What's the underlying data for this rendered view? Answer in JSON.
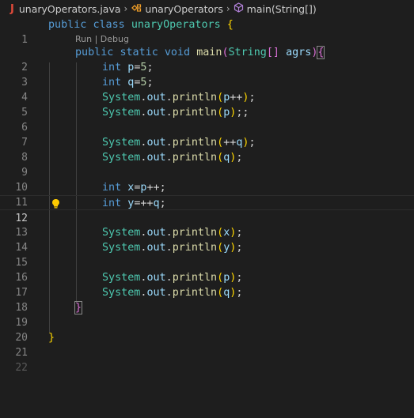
{
  "breadcrumb": {
    "file_icon": "J",
    "file": "unaryOperators.java",
    "class": "unaryOperators",
    "method": "main(String[])"
  },
  "codelens": {
    "run": "Run",
    "sep": " | ",
    "debug": "Debug"
  },
  "line_numbers": [
    "1",
    "2",
    "3",
    "4",
    "5",
    "6",
    "7",
    "8",
    "9",
    "10",
    "11",
    "12",
    "13",
    "14",
    "15",
    "16",
    "17",
    "18",
    "19",
    "20",
    "21",
    "22"
  ],
  "active_line": 12,
  "code": {
    "l1": [
      "public",
      "class",
      "unaryOperators",
      "{"
    ],
    "l2": [
      "public",
      "static",
      "void",
      "main",
      "(",
      "String",
      "[]",
      "agrs",
      ")",
      "{"
    ],
    "l3": [
      "int",
      "p",
      "=",
      "5",
      ";"
    ],
    "l4": [
      "int",
      "q",
      "=",
      "5",
      ";"
    ],
    "l5": [
      "System",
      ".",
      "out",
      ".",
      "println",
      "(",
      "p",
      "++",
      ")",
      ";"
    ],
    "l6": [
      "System",
      ".",
      "out",
      ".",
      "println",
      "(",
      "p",
      ")",
      ";;"
    ],
    "l8": [
      "System",
      ".",
      "out",
      ".",
      "println",
      "(",
      "++",
      "q",
      ")",
      ";"
    ],
    "l9": [
      "System",
      ".",
      "out",
      ".",
      "println",
      "(",
      "q",
      ")",
      ";"
    ],
    "l11": [
      "int",
      "x",
      "=",
      "p",
      "++",
      ";"
    ],
    "l12": [
      "int",
      "y",
      "=",
      "++",
      "q",
      ";"
    ],
    "l14": [
      "System",
      ".",
      "out",
      ".",
      "println",
      "(",
      "x",
      ")",
      ";"
    ],
    "l15": [
      "System",
      ".",
      "out",
      ".",
      "println",
      "(",
      "y",
      ")",
      ";"
    ],
    "l17": [
      "System",
      ".",
      "out",
      ".",
      "println",
      "(",
      "p",
      ")",
      ";"
    ],
    "l18": [
      "System",
      ".",
      "out",
      ".",
      "println",
      "(",
      "q",
      ")",
      ";"
    ],
    "l19": [
      "}"
    ],
    "l21": [
      "}"
    ]
  },
  "icons": {
    "file_icon": "java-file-icon",
    "class_icon": "class-symbol-icon",
    "method_icon": "method-symbol-icon",
    "bulb_icon": "lightbulb-icon",
    "separator_icon": "chevron-right-icon"
  },
  "colors": {
    "background": "#1e1e1e",
    "keyword": "#569cd6",
    "type": "#4ec9b0",
    "function": "#dcdcaa",
    "variable": "#9cdcfe",
    "number": "#b5cea8",
    "bracket_level1": "#ffd700",
    "bracket_level2": "#da70d6",
    "line_number": "#858585"
  }
}
